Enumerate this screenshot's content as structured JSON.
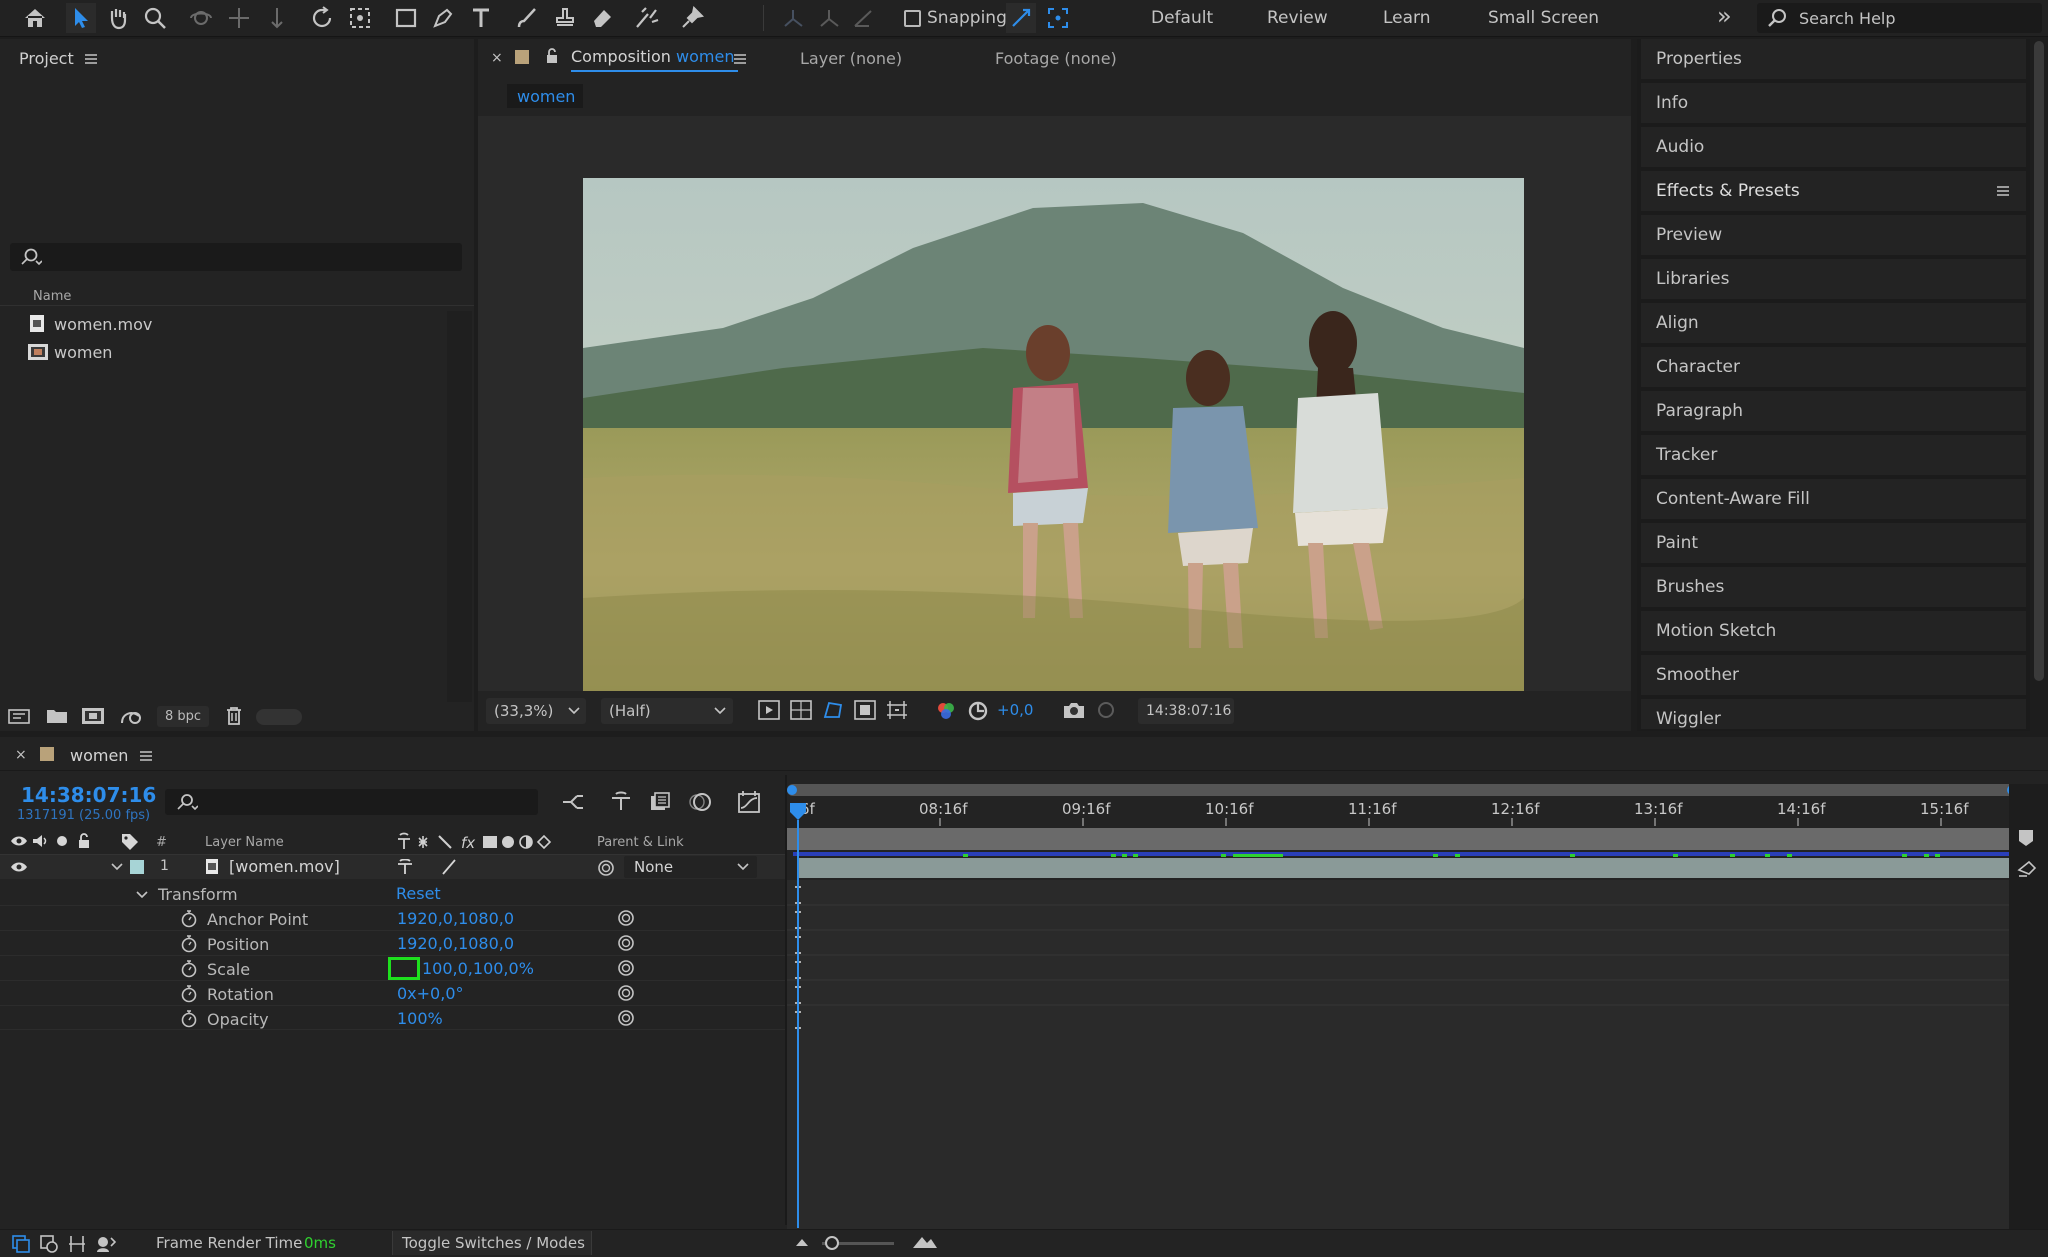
{
  "toolbar": {
    "snapping_label": "Snapping",
    "workspaces": [
      "Default",
      "Review",
      "Learn",
      "Small Screen"
    ],
    "search_placeholder": "Search Help",
    "more_glyph": "»"
  },
  "project": {
    "title": "Project",
    "name_header": "Name",
    "items": [
      {
        "name": "women.mov",
        "icon": "footage-file-icon"
      },
      {
        "name": "women",
        "icon": "composition-icon"
      }
    ],
    "bpc": "8 bpc"
  },
  "composition": {
    "tab_prefix": "Composition",
    "tab_name": "women",
    "layer_tab": "Layer (none)",
    "footage_tab": "Footage (none)",
    "breadcrumb": "women",
    "zoom": "(33,3%)",
    "resolution": "(Half)",
    "exposure": "+0,0",
    "timecode": "14:38:07:16"
  },
  "right_panel": {
    "items": [
      "Properties",
      "Info",
      "Audio",
      "Effects & Presets",
      "Preview",
      "Libraries",
      "Align",
      "Character",
      "Paragraph",
      "Tracker",
      "Content-Aware Fill",
      "Paint",
      "Brushes",
      "Motion Sketch",
      "Smoother",
      "Wiggler"
    ]
  },
  "timeline": {
    "comp_name": "women",
    "current_time": "14:38:07:16",
    "frame_info": "1317191 (25.00 fps)",
    "headers": {
      "num": "#",
      "layer_name": "Layer Name",
      "parent": "Parent & Link"
    },
    "layer": {
      "number": "1",
      "name": "[women.mov]",
      "parent": "None",
      "label_color": "#a7d4d6"
    },
    "transform_label": "Transform",
    "reset_label": "Reset",
    "properties": [
      {
        "name": "Anchor Point",
        "value": "1920,0,1080,0"
      },
      {
        "name": "Position",
        "value": "1920,0,1080,0"
      },
      {
        "name": "Scale",
        "value": "100,0,100,0%"
      },
      {
        "name": "Rotation",
        "value": "0x+0,0°"
      },
      {
        "name": "Opacity",
        "value": "100%"
      }
    ],
    "ruler": [
      "6f",
      "08:16f",
      "09:16f",
      "10:16f",
      "11:16f",
      "12:16f",
      "13:16f",
      "14:16f",
      "15:16f"
    ]
  },
  "status_bar": {
    "render_label": "Frame Render Time",
    "render_value": "0ms",
    "toggle_label": "Toggle Switches / Modes"
  },
  "colors": {
    "accent": "#2e8dea",
    "highlight_box": "#1ee01e",
    "layer_bar": "#8a9a98"
  }
}
